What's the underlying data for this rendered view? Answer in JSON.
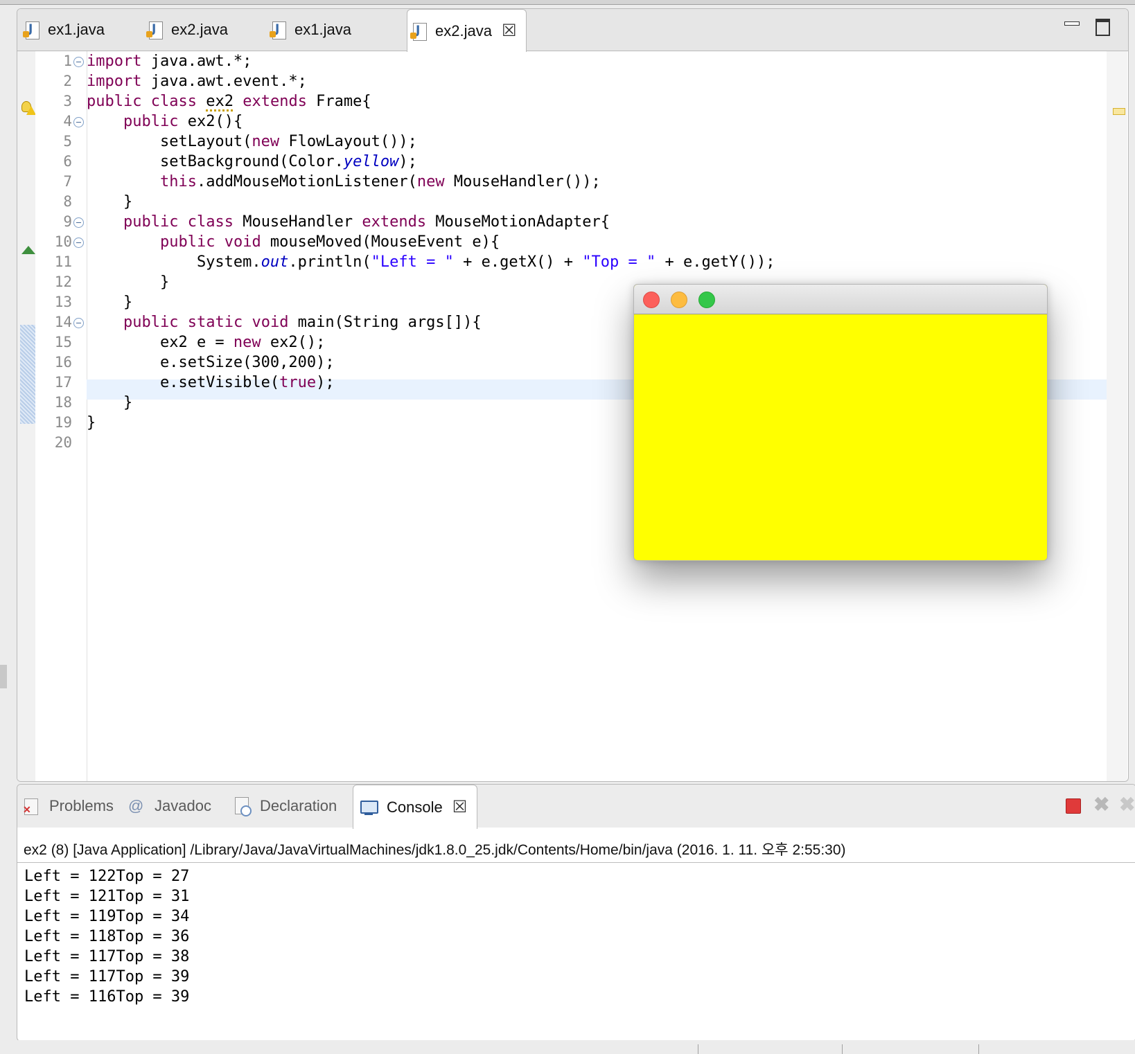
{
  "editor": {
    "tabs": [
      {
        "label": "ex1.java"
      },
      {
        "label": "ex2.java"
      },
      {
        "label": "ex1.java"
      },
      {
        "label": "ex2.java"
      }
    ],
    "line_numbers": [
      "1",
      "2",
      "3",
      "4",
      "5",
      "6",
      "7",
      "8",
      "9",
      "10",
      "11",
      "12",
      "13",
      "14",
      "15",
      "16",
      "17",
      "18",
      "19",
      "20"
    ],
    "code": {
      "l1": [
        "import",
        " java.awt.*;"
      ],
      "l2": [
        "import",
        " java.awt.event.*;"
      ],
      "l3": [
        "public",
        " ",
        "class",
        " ",
        "ex2",
        " ",
        "extends",
        " Frame{"
      ],
      "l4": [
        "    ",
        "public",
        " ex2(){"
      ],
      "l5": [
        "        setLayout(",
        "new",
        " FlowLayout());"
      ],
      "l6": [
        "        setBackground(Color.",
        "yellow",
        ");"
      ],
      "l7": [
        "        ",
        "this",
        ".addMouseMotionListener(",
        "new",
        " MouseHandler());"
      ],
      "l8": [
        "    }"
      ],
      "l9": [
        "    ",
        "public",
        " ",
        "class",
        " MouseHandler ",
        "extends",
        " MouseMotionAdapter{"
      ],
      "l10": [
        "        ",
        "public",
        " ",
        "void",
        " mouseMoved(MouseEvent e){"
      ],
      "l11": [
        "            System.",
        "out",
        ".println(",
        "\"Left = \"",
        " + e.getX() + ",
        "\"Top = \"",
        " + e.getY());"
      ],
      "l12": [
        "        }"
      ],
      "l13": [
        "    }"
      ],
      "l14": [
        "    ",
        "public",
        " ",
        "static",
        " ",
        "void",
        " main(String args[]){"
      ],
      "l15": [
        "        ex2 e = ",
        "new",
        " ex2();"
      ],
      "l16": [
        "        e.setSize(300,200);"
      ],
      "l17": [
        "        e.setVisible(",
        "true",
        ");"
      ],
      "l18": [
        "    }"
      ],
      "l19": [
        "}"
      ]
    }
  },
  "bottom_panel": {
    "tabs": [
      {
        "label": "Problems"
      },
      {
        "label": "Javadoc"
      },
      {
        "label": "Declaration"
      },
      {
        "label": "Console"
      }
    ],
    "console": {
      "header": "ex2 (8) [Java Application] /Library/Java/JavaVirtualMachines/jdk1.8.0_25.jdk/Contents/Home/bin/java (2016. 1. 11. 오후 2:55:30)",
      "output": [
        "Left = 122Top = 27",
        "Left = 121Top = 31",
        "Left = 119Top = 34",
        "Left = 118Top = 36",
        "Left = 117Top = 38",
        "Left = 117Top = 39",
        "Left = 116Top = 39"
      ]
    }
  },
  "frame_window": {
    "background_color": "#ffff00"
  },
  "colors": {
    "keyword": "#7f0055",
    "string": "#2a00ff",
    "static_field": "#0000c0",
    "current_line": "#e8f2fe"
  },
  "icons": {
    "tab_file": "java-file-icon",
    "close": "close-icon",
    "minimize": "minimize-icon",
    "maximize": "maximize-icon",
    "warning": "warning-icon",
    "override": "override-icon",
    "problems": "problems-icon",
    "javadoc": "javadoc-icon",
    "declaration": "declaration-icon",
    "console": "console-icon",
    "terminate": "terminate-icon",
    "remove_launch": "remove-launch-icon"
  }
}
